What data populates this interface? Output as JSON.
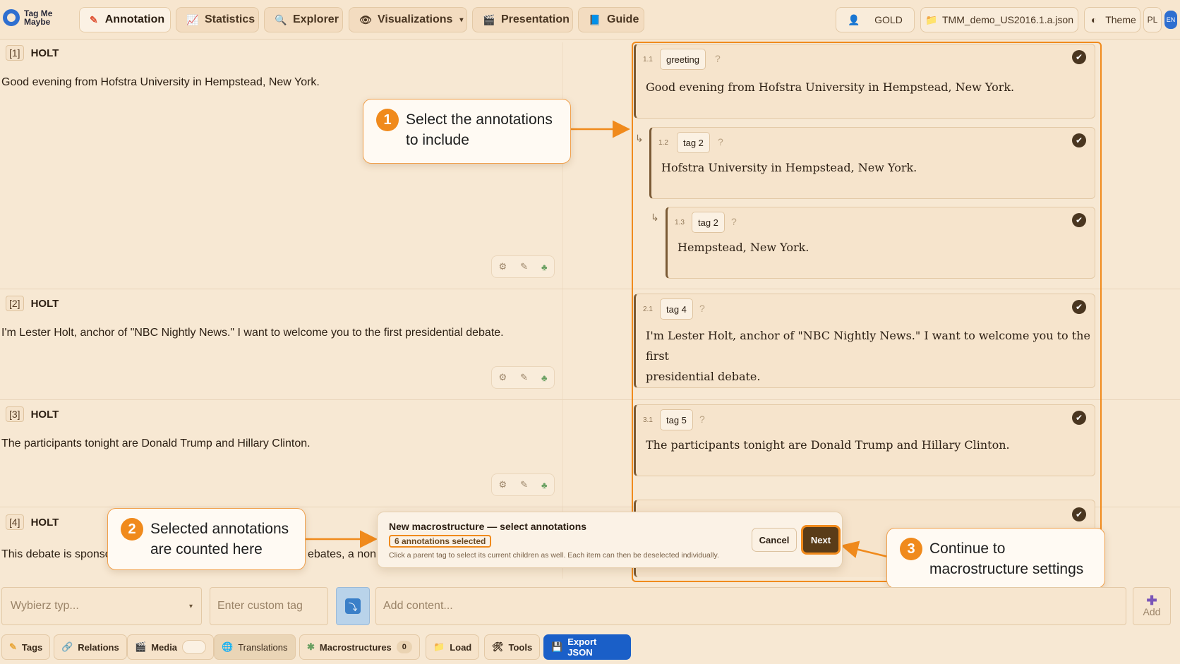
{
  "app": {
    "logo_line1": "Tag Me",
    "logo_line2": "Maybe"
  },
  "nav": {
    "annotation": "Annotation",
    "statistics": "Statistics",
    "explorer": "Explorer",
    "visualizations": "Visualizations",
    "presentation": "Presentation",
    "guide": "Guide",
    "user_level": "GOLD",
    "file_name": "TMM_demo_US2016.1.a.json",
    "theme": "Theme",
    "lang_pl": "PL",
    "lang_en": "EN"
  },
  "utterances": [
    {
      "idx": "[1]",
      "speaker": "HOLT",
      "text": "Good evening from Hofstra University in Hempstead, New York."
    },
    {
      "idx": "[2]",
      "speaker": "HOLT",
      "text": "I'm Lester Holt, anchor of \"NBC Nightly News.\" I want to welcome you to the first presidential debate."
    },
    {
      "idx": "[3]",
      "speaker": "HOLT",
      "text": "The participants tonight are Donald Trump and Hillary Clinton."
    },
    {
      "idx": "[4]",
      "speaker": "HOLT",
      "text": "This debate is sponsc"
    }
  ],
  "utterance4_tail": "ebates, a nonp",
  "annotations": [
    {
      "num": "1.1",
      "tag": "greeting",
      "q": "?",
      "text": "Good evening from Hofstra University in Hempstead, New York."
    },
    {
      "num": "1.2",
      "tag": "tag 2",
      "q": "?",
      "text": "Hofstra University in Hempstead, New York."
    },
    {
      "num": "1.3",
      "tag": "tag 2",
      "q": "?",
      "text": "Hempstead, New York."
    },
    {
      "num": "2.1",
      "tag": "tag 4",
      "q": "?",
      "text_line1": "I'm Lester Holt, anchor of \"NBC Nightly News.\" I want to welcome you to the first",
      "text_line2": "presidential debate."
    },
    {
      "num": "3.1",
      "tag": "tag 5",
      "q": "?",
      "text": "The participants tonight are Donald Trump and Hillary Clinton."
    }
  ],
  "callouts": {
    "c1_num": "1",
    "c1_line1": "Select the annotations",
    "c1_line2": "to include",
    "c2_num": "2",
    "c2_line1": "Selected annotations",
    "c2_line2": "are counted here",
    "c3_num": "3",
    "c3_line1": "Continue to",
    "c3_line2": "macrostructure settings"
  },
  "dialog": {
    "title": "New macrostructure — select annotations",
    "count": "6 annotations selected",
    "hint": "Click a parent tag to select its current children as well. Each item can then be deselected individually.",
    "cancel": "Cancel",
    "next": "Next"
  },
  "inputs": {
    "type_placeholder": "Wybierz typ...",
    "custom_tag_placeholder": "Enter custom tag",
    "content_placeholder": "Add content...",
    "add": "Add"
  },
  "bottom": {
    "tags": "Tags",
    "relations": "Relations",
    "media": "Media",
    "translations": "Translations",
    "macrostructures": "Macrostructures",
    "macro_count": "0",
    "load": "Load",
    "tools": "Tools",
    "export": "Export JSON"
  },
  "colors": {
    "accent": "#f08a1c",
    "export": "#1a5fc8",
    "next": "#5a3c18"
  }
}
